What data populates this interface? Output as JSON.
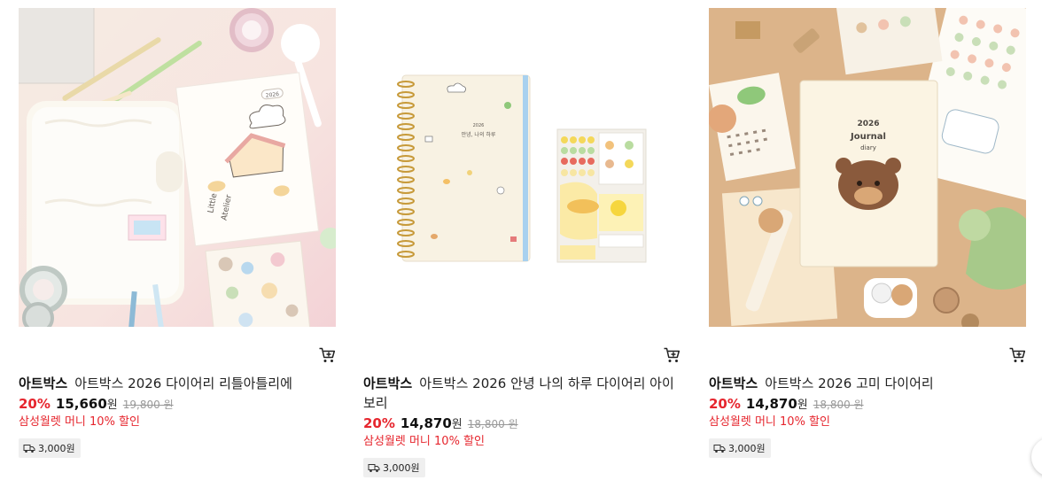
{
  "products": [
    {
      "brand": "아트박스",
      "name": "아트박스 2026 다이어리 리틀아틀리에",
      "discount": "20%",
      "price": "15,660",
      "currency": "원",
      "original_price": "19,800 원",
      "promo": "삼성월렛 머니 10% 할인",
      "shipping": "3,000원",
      "image_text": [
        "Little Atelier",
        "2026"
      ]
    },
    {
      "brand": "아트박스",
      "name": "아트박스 2026 안녕 나의 하루 다이어리 아이보리",
      "discount": "20%",
      "price": "14,870",
      "currency": "원",
      "original_price": "18,800 원",
      "promo": "삼성월렛 머니 10% 할인",
      "shipping": "3,000원",
      "image_text": [
        "2026",
        "안녕, 나의 하루"
      ]
    },
    {
      "brand": "아트박스",
      "name": "아트박스 2026 고미 다이어리",
      "discount": "20%",
      "price": "14,870",
      "currency": "원",
      "original_price": "18,800 원",
      "promo": "삼성월렛 머니 10% 할인",
      "shipping": "3,000원",
      "image_text": [
        "2026",
        "Journal",
        "diary"
      ]
    }
  ],
  "colors": {
    "discount": "#e6262e",
    "promo": "#e6262e",
    "shipping_badge_bg": "#efefef"
  },
  "icons": {
    "cart": "cart-icon",
    "shipping": "truck-icon",
    "next": "chevron-right-icon"
  }
}
